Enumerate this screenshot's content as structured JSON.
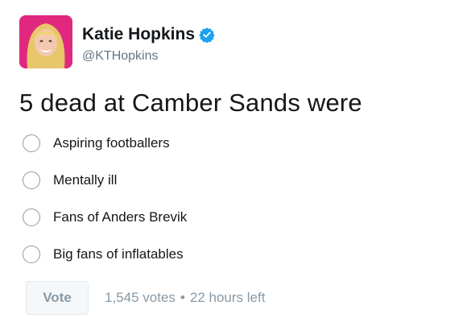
{
  "author": {
    "display_name": "Katie Hopkins",
    "handle": "@KTHopkins",
    "verified_icon": "verified-badge-icon"
  },
  "tweet": {
    "text": "5 dead at Camber Sands were"
  },
  "poll": {
    "options": [
      {
        "label": "Aspiring footballers"
      },
      {
        "label": "Mentally ill"
      },
      {
        "label": "Fans of Anders Brevik"
      },
      {
        "label": "Big fans of inflatables"
      }
    ],
    "vote_label": "Vote",
    "votes": "1,545 votes",
    "separator": "•",
    "time_left": "22 hours left"
  },
  "colors": {
    "verified": "#1da1f2",
    "avatar_bg": "#e0287e",
    "muted_text": "#657786"
  }
}
